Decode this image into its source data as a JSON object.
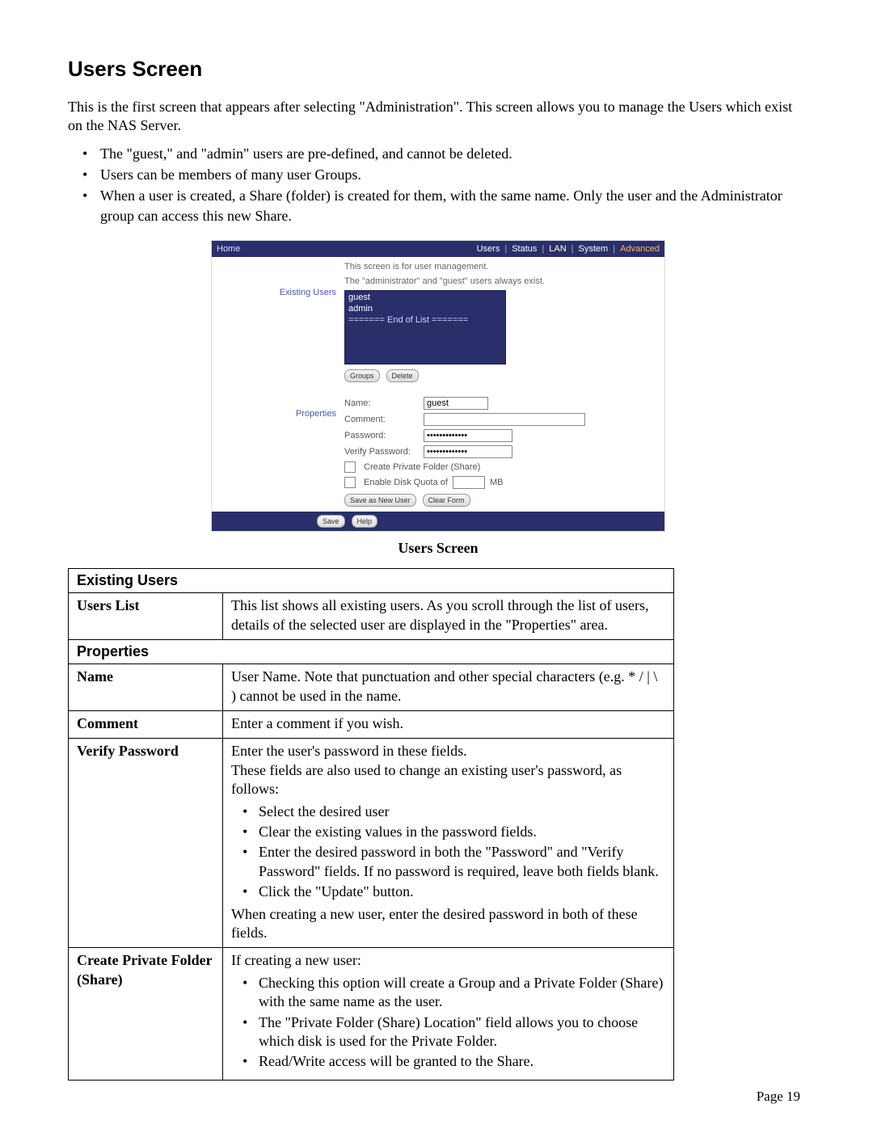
{
  "heading": "Users Screen",
  "intro": "This is the first screen that appears after selecting \"Administration\". This screen allows you to manage the Users which exist on the NAS Server.",
  "top_bullets": [
    "The \"guest,\" and \"admin\" users are pre-defined, and cannot be deleted.",
    "Users can be members of many user Groups.",
    "When a user is created, a Share (folder) is created for them, with the same name. Only the user and the Administrator group can access this new Share."
  ],
  "shot": {
    "home": "Home",
    "nav": {
      "users": "Users",
      "status": "Status",
      "lan": "LAN",
      "system": "System",
      "advanced": "Advanced"
    },
    "desc1": "This screen is for user management.",
    "desc2": "The \"administrator\" and \"guest\" users always exist.",
    "left_existing": "Existing Users",
    "left_properties": "Properties",
    "list": {
      "guest": "guest",
      "admin": "admin",
      "eol": "======= End of List ======="
    },
    "btn_groups": "Groups",
    "btn_delete": "Delete",
    "form": {
      "name_label": "Name:",
      "name_value": "guest",
      "comment_label": "Comment:",
      "password_label": "Password:",
      "password_value": "•••••••••••••",
      "verify_label": "Verify Password:",
      "verify_value": "•••••••••••••",
      "cb_private": "Create Private Folder (Share)",
      "cb_quota": "Enable Disk Quota of",
      "quota_unit": "MB"
    },
    "btn_save_new": "Save as New User",
    "btn_clear": "Clear Form",
    "btn_save": "Save",
    "btn_help": "Help"
  },
  "caption": "Users Screen",
  "table": {
    "g1": "Existing Users",
    "r1_key": "Users List",
    "r1_val": "This list shows all existing users. As you scroll through the list of users, details of the selected user are displayed in the \"Properties\" area.",
    "g2": "Properties",
    "r2_key": "Name",
    "r2_val": "User Name. Note that punctuation and other special characters (e.g. * / | \\ ) cannot be used in the name.",
    "r3_key": "Comment",
    "r3_val": "Enter a comment if you wish.",
    "r4_key": "Verify Password",
    "r4_intro": "Enter the user's password in these fields.",
    "r4_intro2": "These fields are also used to change an existing user's password, as follows:",
    "r4_steps": [
      "Select the desired user",
      "Clear the existing values in the password fields.",
      "Enter the desired password in both the \"Password\" and \"Verify Password\" fields. If no password is required, leave both fields blank.",
      "Click the \"Update\" button."
    ],
    "r4_outro": "When creating a new user, enter the desired password in both of these fields.",
    "r5_key": "Create Private Folder (Share)",
    "r5_intro": "If creating a new user:",
    "r5_items": [
      "Checking this option will create a Group and a Private Folder (Share) with the same name as the user.",
      "The \"Private Folder (Share) Location\" field allows you to choose which disk is used for the Private Folder.",
      "Read/Write access will be granted to the Share."
    ]
  },
  "page_label": "Page 19"
}
